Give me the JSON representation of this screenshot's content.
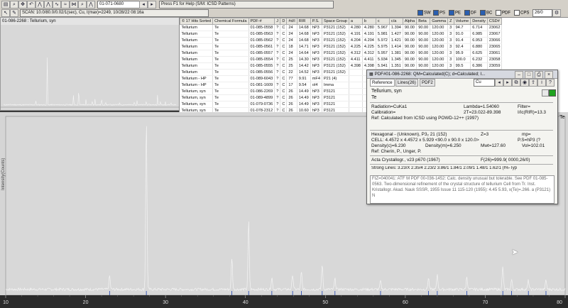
{
  "toolbar": {
    "pdf_field": "01-071-0680",
    "help_text": "Press F1 for Help (S/M: ICSD Patterns)",
    "scan_text": "SCAN: 10.0/80.0/0.02/1(sec), Cu, I(max)=2249, 10/28/22 08:16a",
    "toggles": [
      {
        "label": "SW",
        "on": true
      },
      {
        "label": "PS",
        "on": true
      },
      {
        "label": "PE",
        "on": true
      },
      {
        "label": "DF",
        "on": true
      },
      {
        "label": "BC",
        "on": true
      },
      {
        "label": "PDF",
        "on": false
      },
      {
        "label": "CPS",
        "on": false
      }
    ],
    "zoom_value": "26/0"
  },
  "upper_plot": {
    "title": "01-086-2268 : Tellurium, syn"
  },
  "table": {
    "headers": [
      "© 17 Hits Sorted",
      "Chemical Formula",
      "PDF-#",
      "J",
      "D",
      "#d/I",
      "RIR",
      "P.S.",
      "Space Group",
      "a",
      "b",
      "c",
      "c/a",
      "Alpha",
      "Beta",
      "Gamma",
      "Z",
      "Volume",
      "Density",
      "CSD#"
    ],
    "rows": [
      [
        "Tellurium",
        "Te",
        "01-085-0558",
        "?",
        "C",
        "24",
        "14.68",
        "hP3",
        "P3121 (152)",
        "4.280",
        "4.280",
        "5.967",
        "1.394",
        "90.00",
        "90.00",
        "120.00",
        "3",
        "94.7",
        "6.714",
        "23062"
      ],
      [
        "Tellurium",
        "Te",
        "01-085-0563",
        "?",
        "C",
        "24",
        "14.68",
        "hP3",
        "P3121 (152)",
        "4.191",
        "4.191",
        "5.981",
        "1.427",
        "90.00",
        "90.00",
        "120.00",
        "3",
        "91.0",
        "6.985",
        "23067"
      ],
      [
        "Tellurium",
        "Te",
        "01-085-0562",
        "?",
        "C",
        "24",
        "14.68",
        "hP3",
        "P3121 (152)",
        "4.204",
        "4.204",
        "5.972",
        "1.421",
        "90.00",
        "90.00",
        "120.00",
        "3",
        "91.4",
        "6.953",
        "23066"
      ],
      [
        "Tellurium",
        "Te",
        "01-085-0561",
        "?",
        "C",
        "18",
        "14.71",
        "hP3",
        "P3121 (152)",
        "4.225",
        "4.225",
        "5.975",
        "1.414",
        "90.00",
        "90.00",
        "120.00",
        "3",
        "92.4",
        "6.880",
        "23065"
      ],
      [
        "Tellurium",
        "Te",
        "01-085-0557",
        "?",
        "C",
        "24",
        "14.64",
        "hP3",
        "P3121 (152)",
        "4.312",
        "4.312",
        "5.957",
        "1.381",
        "90.00",
        "90.00",
        "120.00",
        "3",
        "95.9",
        "6.625",
        "23061"
      ],
      [
        "Tellurium",
        "Te",
        "01-085-0554",
        "?",
        "C",
        "25",
        "14.30",
        "hP3",
        "P3121 (152)",
        "4.411",
        "4.411",
        "5.934",
        "1.345",
        "90.00",
        "90.00",
        "120.00",
        "3",
        "100.0",
        "6.232",
        "23058"
      ],
      [
        "Tellurium",
        "Te",
        "01-085-0555",
        "?",
        "C",
        "25",
        "14.42",
        "hP3",
        "P3121 (152)",
        "4.398",
        "4.398",
        "5.941",
        "1.351",
        "90.00",
        "90.00",
        "120.00",
        "3",
        "99.5",
        "6.386",
        "23059"
      ],
      [
        "Tellurium",
        "Te",
        "01-085-0556",
        "?",
        "C",
        "22",
        "14.52",
        "hP3",
        "P3121 (152)",
        "",
        "",
        "",
        "",
        "",
        "",
        "",
        "",
        "",
        "",
        ""
      ],
      [
        "Tellurium - HP",
        "Te",
        "01-089-6043",
        "?",
        "C",
        "77",
        "9.91",
        "mF4",
        "P21 (4)",
        "",
        "",
        "",
        "",
        "",
        "",
        "",
        "",
        "",
        "",
        ""
      ],
      [
        "Tellurium - HP",
        "Te",
        "01-081-1609",
        "?",
        "C",
        "17",
        "9.54",
        "oI4",
        "Imma",
        "",
        "",
        "",
        "",
        "",
        "",
        "",
        "",
        "",
        "",
        ""
      ],
      [
        "Tellurium, syn",
        "Te",
        "01-086-2269",
        "?",
        "C",
        "26",
        "14.49",
        "hP3",
        "P3121",
        "",
        "",
        "",
        "",
        "",
        "",
        "",
        "",
        "",
        "",
        ""
      ],
      [
        "Tellurium, syn",
        "Te",
        "01-089-4899",
        "?",
        "C",
        "26",
        "14.49",
        "hP3",
        "P3121",
        "",
        "",
        "",
        "",
        "",
        "",
        "",
        "",
        "",
        "",
        ""
      ],
      [
        "Tellurium, syn",
        "Te",
        "01-079-0736",
        "?",
        "C",
        "26",
        "14.49",
        "hP3",
        "P3121",
        "",
        "",
        "",
        "",
        "",
        "",
        "",
        "",
        "",
        "",
        ""
      ],
      [
        "Tellurium, syn",
        "Te",
        "01-078-2312",
        "?",
        "C",
        "26",
        "10.60",
        "hP3",
        "P3121",
        "",
        "",
        "",
        "",
        "",
        "",
        "",
        "",
        "",
        "",
        ""
      ],
      [
        "Tellurium, syn",
        "Te",
        "01-086-2268",
        "?",
        "C",
        "26",
        "13.33",
        "hP3",
        "P3121",
        "",
        "",
        "",
        "",
        "",
        "",
        "",
        "",
        "",
        "",
        ""
      ]
    ],
    "selected_row": 14
  },
  "pdf_card": {
    "title": "PDF#01-086-2268: QM=Calculated(C); d=Calculated; I...",
    "tabs": [
      "Reference",
      "Lines(26)",
      "PDF2"
    ],
    "active_tab": 0,
    "radiation_select": "Cu",
    "name": "Tellurium, syn",
    "formula": "Te",
    "radiation": "Radiation=CuKa1",
    "lambda": "Lambda=1.54060",
    "filter": "Filter=",
    "calibration": "Calibration=",
    "zt": "2T=23.022-89.398",
    "ific": "I/Ic(RIR)=13.3",
    "ref": "Ref: Calculated from ICSD using POWD-12++ (1997)",
    "system": "Hexagonal - (Unknown), P3₂ 21 (152)",
    "z": "Z=3",
    "mp": "mp=",
    "cell": "CELL: 4.4572 x 4.4572 x 5.929 <90.0 x 90.0 x 120.0>",
    "ps": "P.S=hP3 (?",
    "density_c": "Density(c)=6.230",
    "density_m": "Density(m)=6.250",
    "mwt": "Mwt=127.60",
    "vol": "Vol=102.01",
    "ref2": "Ref: Cherin, P., Unger, P.",
    "journal": "Acta Crystallogr., v23 p670 (1967)",
    "fom": "F(26)=999.9( 0000,26/0)",
    "strong_lines": "Strong Lines: 3.23/X 2.35/4 2.23/2 3.86/1 1.84/1 2.09/1 1.48/1 1.62/1 (I%-Typ",
    "comments": "FIZ=040041: ATF M PDF 00-036-1452: Calc. density unusual but tolerable. See PDF 01-085-0563. Two-dimensional refinement of the crystal structure of tellurium Cell from Tr. Inst. Kristallogr. Akad. Nauk SSSR, 1955 Issue 11 115-120 (1955): 4.45 5.93, x(Te)=.266. a (P3121) N"
  },
  "main_plot": {
    "y_axis_label": "Intensity(Counts)",
    "x_ticks": [
      "10",
      "20",
      "30",
      "40",
      "50",
      "60",
      "70",
      "80"
    ],
    "right_label": "- Te"
  },
  "chart_data": {
    "type": "line",
    "xlabel": "",
    "ylabel": "Intensity(Counts)",
    "xlim": [
      10,
      80
    ],
    "ylim": [
      0,
      2249
    ],
    "peaks": [
      {
        "x": 23.0,
        "y": 180
      },
      {
        "x": 27.6,
        "y": 2249
      },
      {
        "x": 38.3,
        "y": 420
      },
      {
        "x": 40.4,
        "y": 900
      },
      {
        "x": 43.3,
        "y": 160
      },
      {
        "x": 45.9,
        "y": 200
      },
      {
        "x": 47.0,
        "y": 230
      },
      {
        "x": 49.6,
        "y": 330
      },
      {
        "x": 51.2,
        "y": 140
      },
      {
        "x": 56.9,
        "y": 110
      },
      {
        "x": 62.9,
        "y": 150
      },
      {
        "x": 64.0,
        "y": 200
      },
      {
        "x": 67.7,
        "y": 170
      },
      {
        "x": 72.2,
        "y": 300
      },
      {
        "x": 73.3,
        "y": 130
      },
      {
        "x": 75.4,
        "y": 120
      },
      {
        "x": 77.6,
        "y": 120
      }
    ],
    "reference_sticks": [
      23.0,
      27.6,
      38.3,
      40.4,
      43.3,
      45.9,
      47.0,
      49.6,
      51.2,
      56.9,
      62.9,
      64.0,
      67.7,
      72.2,
      73.3,
      75.4,
      77.6
    ]
  }
}
